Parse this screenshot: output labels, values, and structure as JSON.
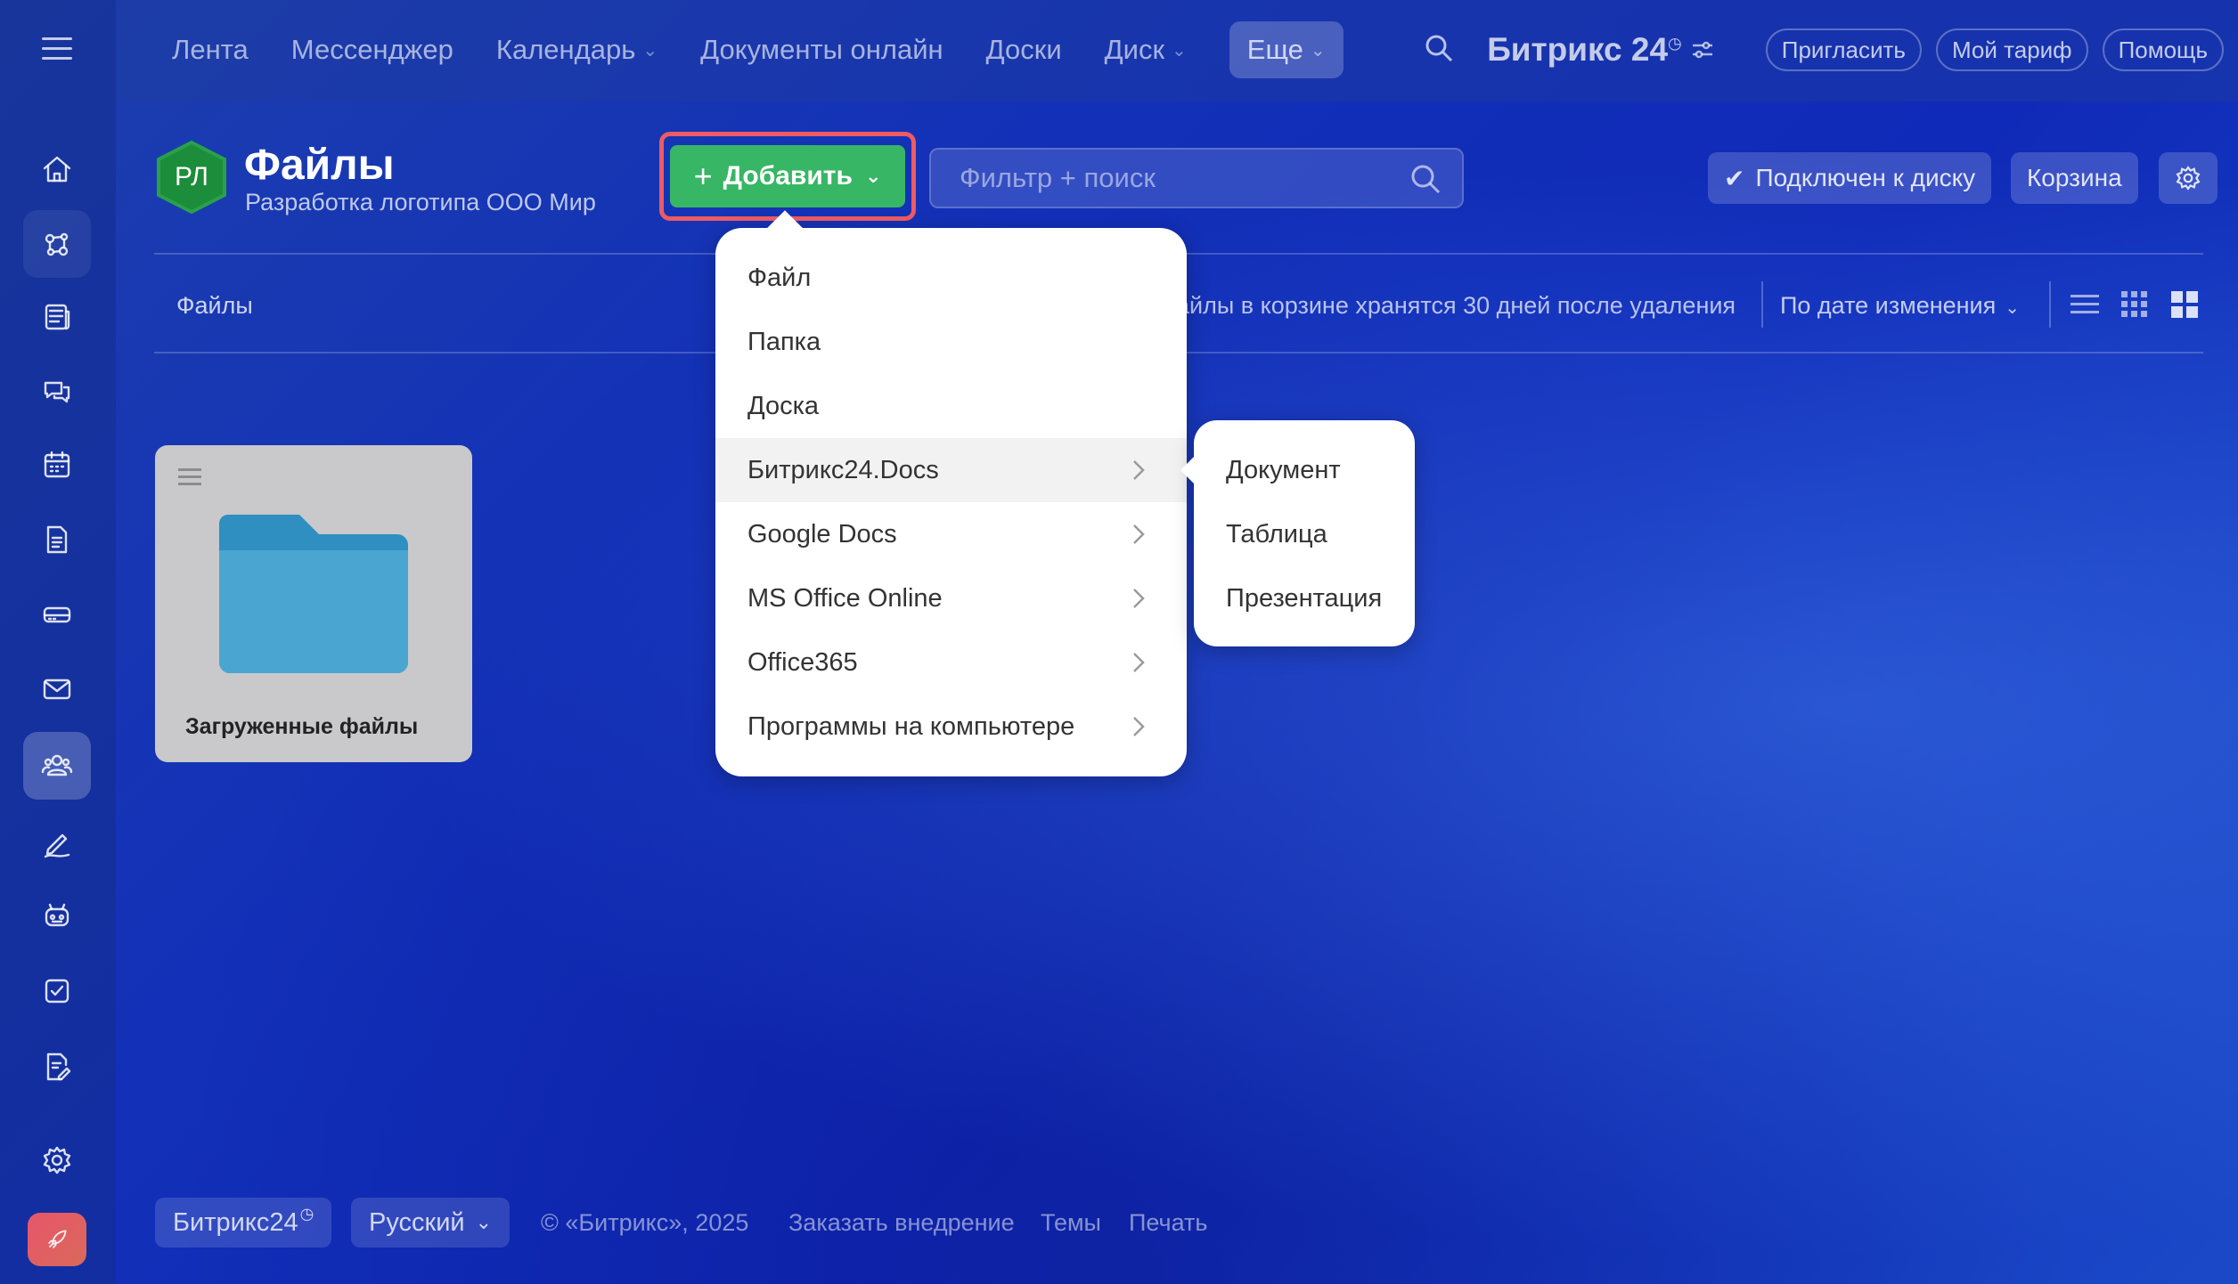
{
  "colors": {
    "accent_green": "#37b665",
    "highlight_red": "#ef5a63",
    "folder_blue": "#4aa6d0"
  },
  "topnav": {
    "items": [
      {
        "label": "Лента",
        "has_dropdown": false
      },
      {
        "label": "Мессенджер",
        "has_dropdown": false
      },
      {
        "label": "Календарь",
        "has_dropdown": true
      },
      {
        "label": "Документы онлайн",
        "has_dropdown": false
      },
      {
        "label": "Доски",
        "has_dropdown": false
      },
      {
        "label": "Диск",
        "has_dropdown": true
      },
      {
        "label": "Еще",
        "has_dropdown": true,
        "active": true
      }
    ],
    "brand": "Битрикс 24",
    "invite_label": "Пригласить",
    "tariff_label": "Мой тариф",
    "help_label": "Помощь"
  },
  "sidebar": {
    "icons": [
      "home-icon",
      "flow-icon",
      "news-icon",
      "chat-icon",
      "calendar-icon",
      "document-icon",
      "drive-icon",
      "mail-icon",
      "group-icon",
      "sign-icon",
      "robot-icon",
      "tasks-icon",
      "edit-doc-icon",
      "settings-icon",
      "rocket-icon"
    ]
  },
  "header": {
    "avatar_initials": "РЛ",
    "title": "Файлы",
    "subtitle": "Разработка логотипа ООО Мир",
    "add_button": "Добавить",
    "filter_placeholder": "Фильтр + поиск",
    "disk_connected": "Подключен к диску",
    "trash": "Корзина"
  },
  "toolbar": {
    "breadcrumb": "Файлы",
    "notice": "айлы в корзине хранятся 30 дней после удаления",
    "sort_label": "По дате изменения"
  },
  "files": [
    {
      "name": "Загруженные файлы",
      "type": "folder"
    }
  ],
  "add_menu": {
    "items": [
      {
        "label": "Файл",
        "submenu": false
      },
      {
        "label": "Папка",
        "submenu": false
      },
      {
        "label": "Доска",
        "submenu": false
      },
      {
        "label": "Битрикс24.Docs",
        "submenu": true,
        "hover": true
      },
      {
        "label": "Google Docs",
        "submenu": true
      },
      {
        "label": "MS Office Online",
        "submenu": true
      },
      {
        "label": "Office365",
        "submenu": true
      },
      {
        "label": "Программы на компьютере",
        "submenu": true
      }
    ],
    "submenu_items": [
      "Документ",
      "Таблица",
      "Презентация"
    ]
  },
  "footer": {
    "brand": "Битрикс24",
    "language": "Русский",
    "copyright": "© «Битрикс», 2025",
    "order": "Заказать внедрение",
    "themes": "Темы",
    "print": "Печать"
  }
}
